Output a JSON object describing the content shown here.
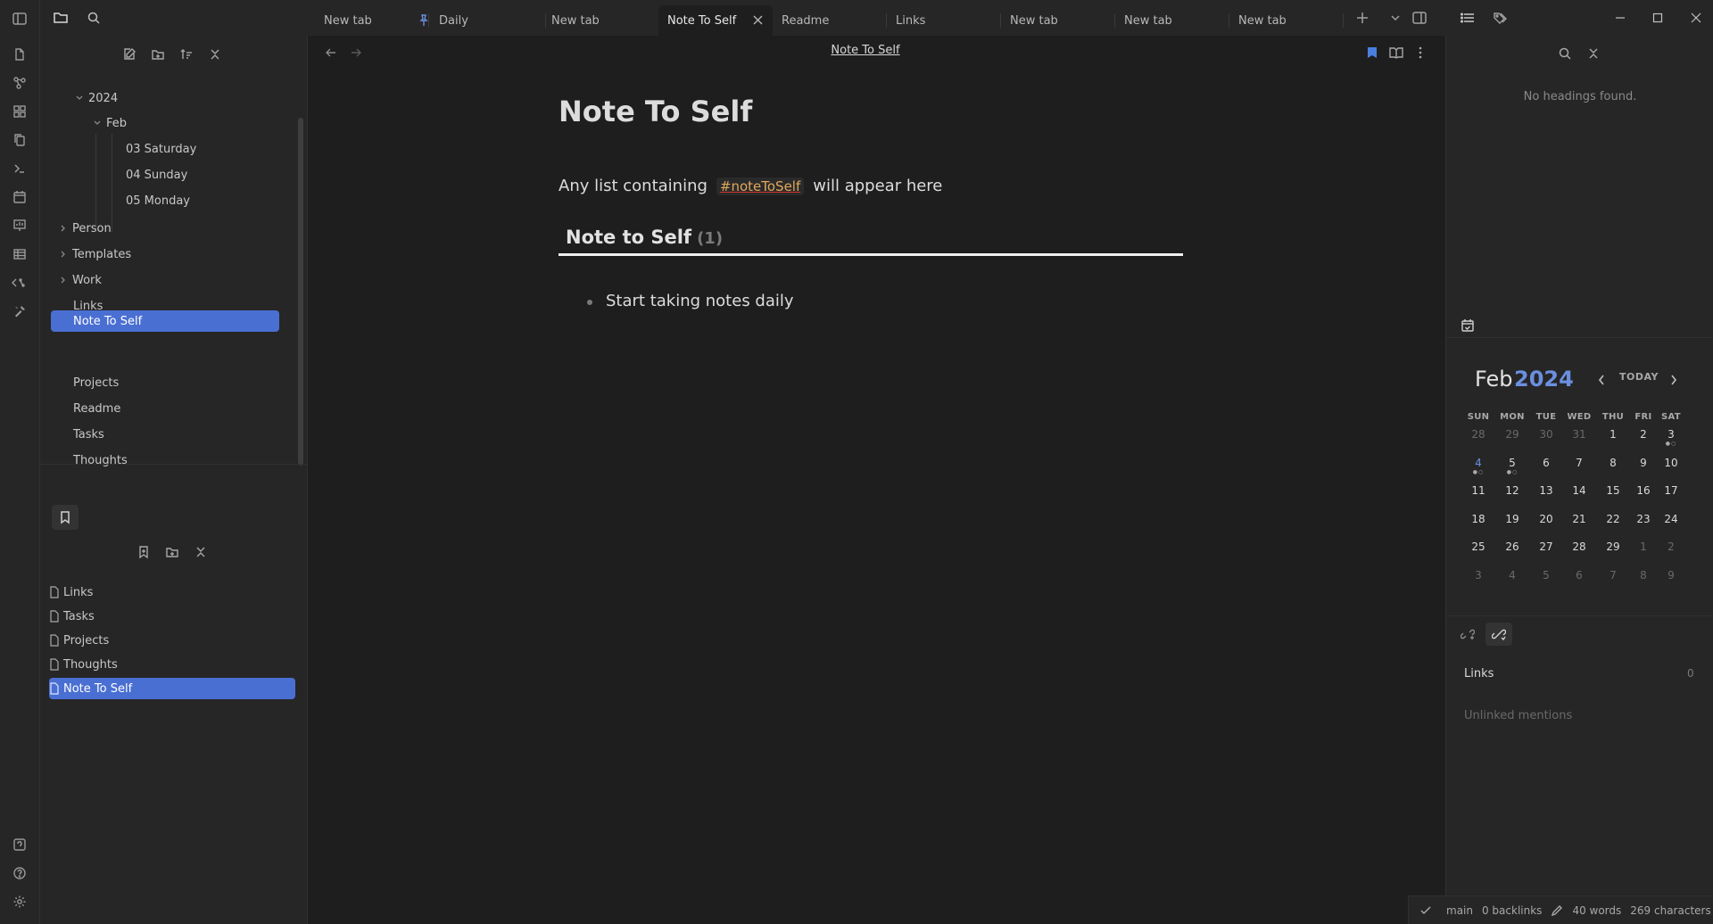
{
  "tabs": [
    {
      "label": "New tab"
    },
    {
      "label": "Daily"
    },
    {
      "label": "New tab"
    },
    {
      "label": "Note To Self"
    },
    {
      "label": "Readme"
    },
    {
      "label": "Links"
    },
    {
      "label": "New tab"
    },
    {
      "label": "New tab"
    },
    {
      "label": "New tab"
    }
  ],
  "tree": {
    "year": "2024",
    "month": "Feb",
    "days": [
      "03 Saturday",
      "04 Sunday",
      "05 Monday"
    ],
    "folders": [
      "Person",
      "Templates",
      "Work"
    ],
    "files": [
      "Links",
      "Note To Self",
      "Projects",
      "Readme",
      "Tasks",
      "Thoughts"
    ]
  },
  "bookmarks": [
    "Links",
    "Tasks",
    "Projects",
    "Thoughts",
    "Note To Self"
  ],
  "editor": {
    "view_title": "Note To Self",
    "title": "Note To Self",
    "intro_before": "Any list containing",
    "tag": "#noteToSelf",
    "intro_after": "will appear here",
    "section_heading": "Note to Self",
    "section_count": "(1)",
    "bullet": "Start taking notes daily"
  },
  "outline": {
    "empty": "No headings found."
  },
  "calendar": {
    "month": "Feb",
    "year": "2024",
    "today_label": "TODAY",
    "weekdays": [
      "SUN",
      "MON",
      "TUE",
      "WED",
      "THU",
      "FRI",
      "SAT"
    ],
    "weeks": [
      [
        "28",
        "29",
        "30",
        "31",
        "1",
        "2",
        "3"
      ],
      [
        "4",
        "5",
        "6",
        "7",
        "8",
        "9",
        "10"
      ],
      [
        "11",
        "12",
        "13",
        "14",
        "15",
        "16",
        "17"
      ],
      [
        "18",
        "19",
        "20",
        "21",
        "22",
        "23",
        "24"
      ],
      [
        "25",
        "26",
        "27",
        "28",
        "29",
        "1",
        "2"
      ],
      [
        "3",
        "4",
        "5",
        "6",
        "7",
        "8",
        "9"
      ]
    ]
  },
  "backlinks": {
    "links_label": "Links",
    "links_count": "0",
    "unlinked": "Unlinked mentions"
  },
  "status": {
    "branch": "main",
    "backlinks": "0 backlinks",
    "words": "40 words",
    "chars": "269 characters"
  },
  "colors": {
    "accent": "#4a6fd3",
    "tag": "#e0a85c",
    "bg": "#1e1e1e",
    "panel": "#262626"
  }
}
